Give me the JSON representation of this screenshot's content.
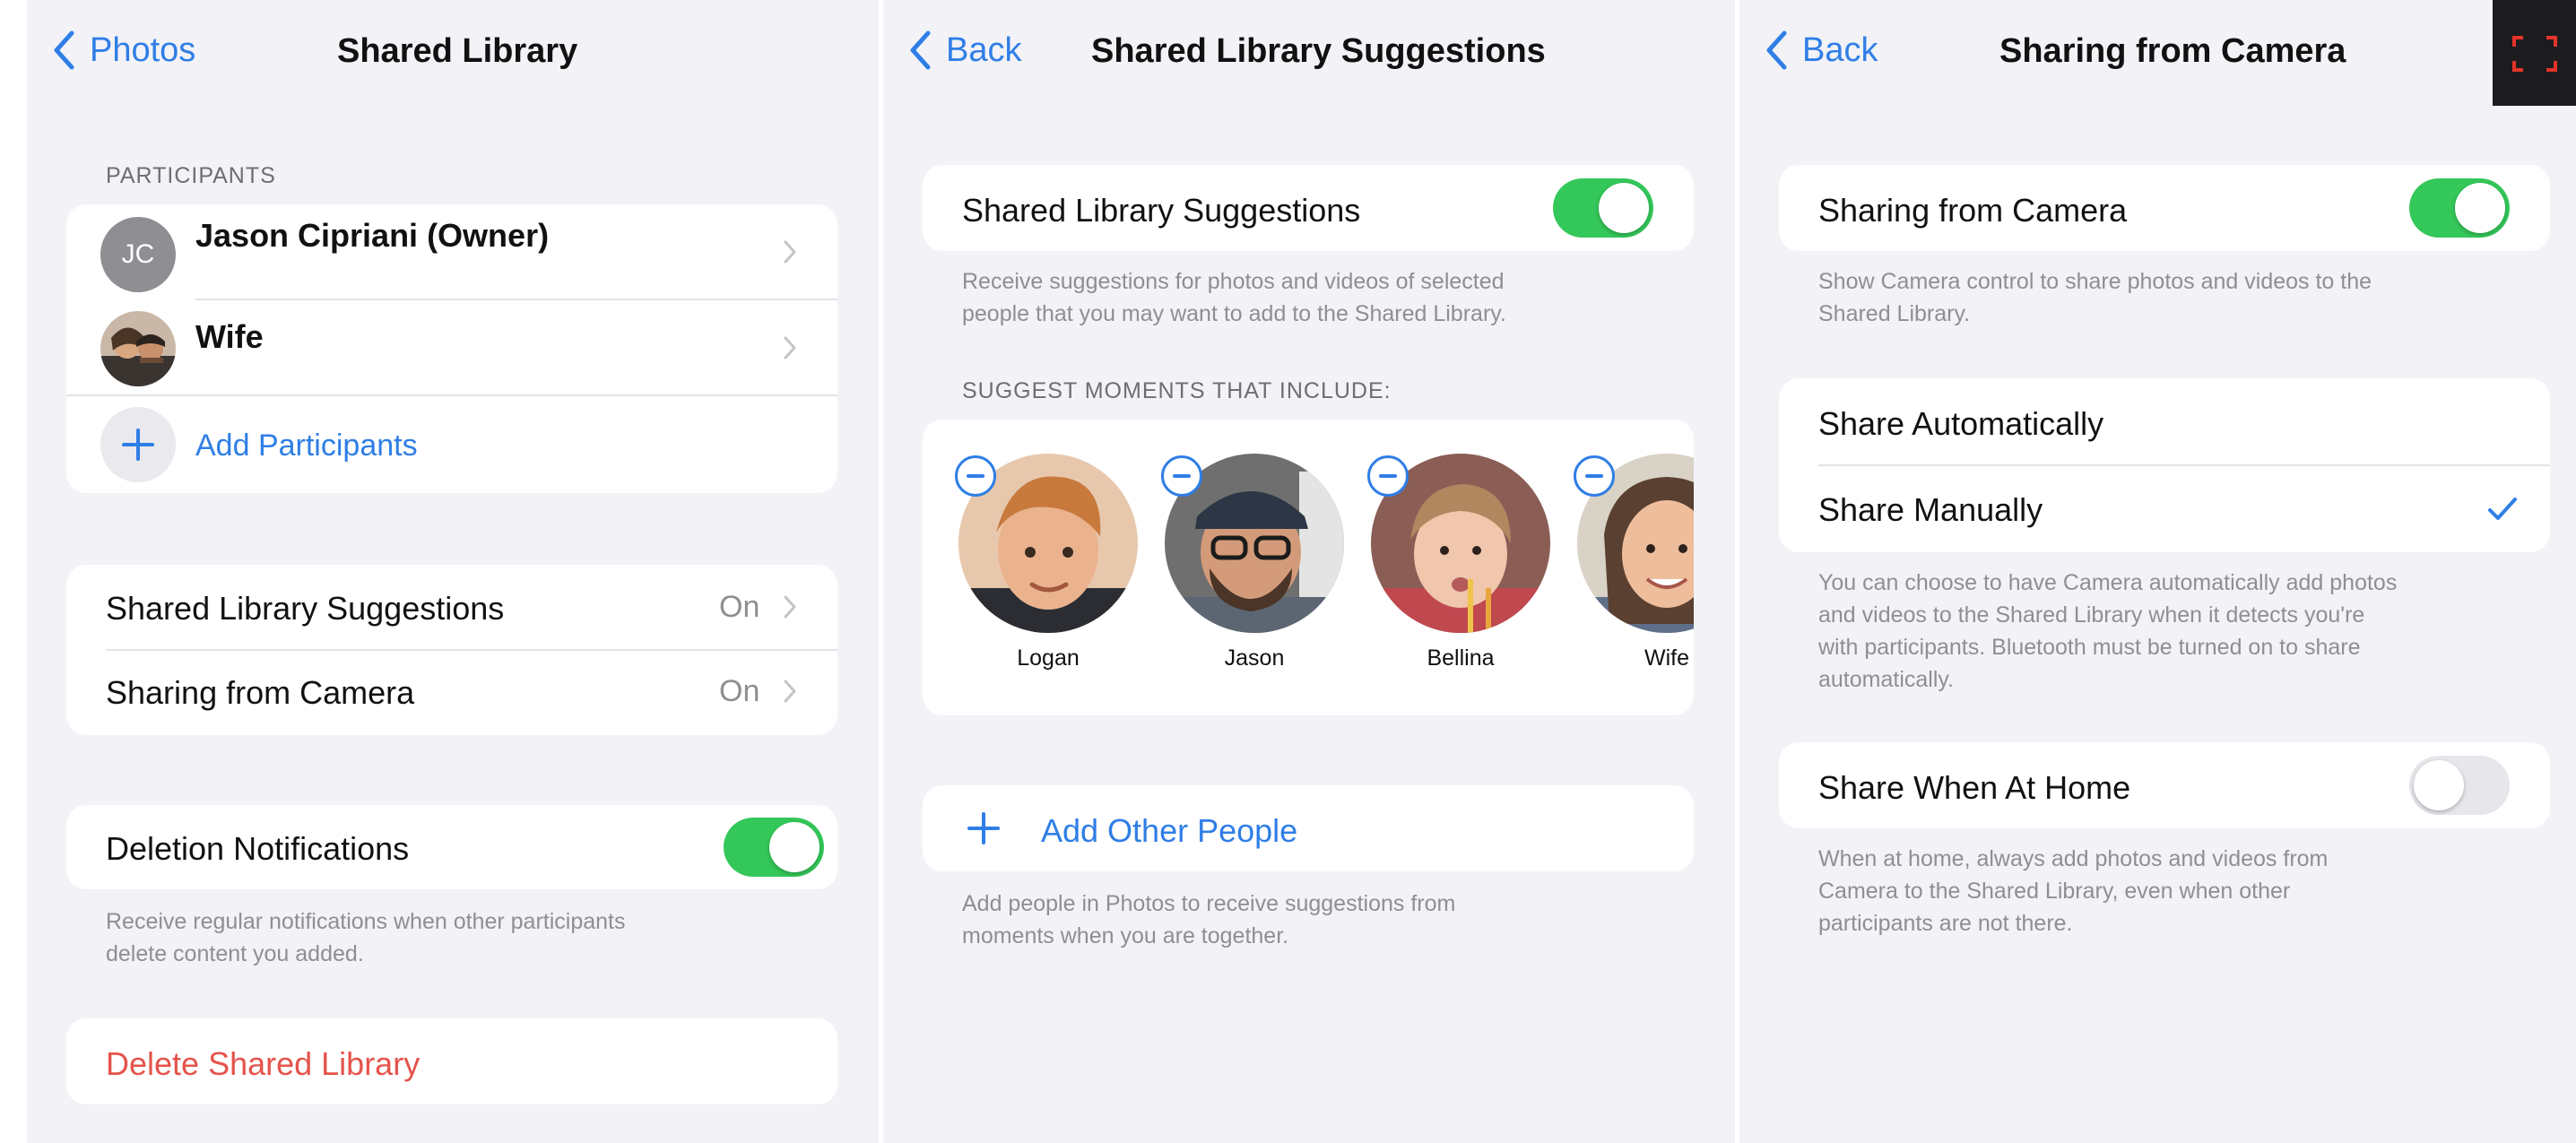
{
  "panel1": {
    "back_label": "Photos",
    "title": "Shared Library",
    "participants_header": "PARTICIPANTS",
    "participants": [
      {
        "initials": "JC",
        "name": "Jason Cipriani (Owner)"
      },
      {
        "initials": "",
        "name": "Wife"
      }
    ],
    "add_participants": "Add Participants",
    "settings": [
      {
        "label": "Shared Library Suggestions",
        "value": "On"
      },
      {
        "label": "Sharing from Camera",
        "value": "On"
      }
    ],
    "deletion_notifications": "Deletion Notifications",
    "deletion_notifications_state": "on",
    "deletion_footnote_1": "Receive regular notifications when other participants",
    "deletion_footnote_2": "delete content you added.",
    "delete_library": "Delete Shared Library"
  },
  "panel2": {
    "back_label": "Back",
    "title": "Shared Library Suggestions",
    "toggle_label": "Shared Library Suggestions",
    "toggle_state": "on",
    "footnote_1": "Receive suggestions for photos and videos of selected",
    "footnote_2": "people that you may want to add to the Shared Library.",
    "moments_header": "SUGGEST MOMENTS THAT INCLUDE:",
    "people": [
      {
        "name": "Logan"
      },
      {
        "name": "Jason"
      },
      {
        "name": "Bellina"
      },
      {
        "name": "Wife"
      }
    ],
    "add_other_people": "Add Other People",
    "add_footnote_1": "Add people in Photos to receive suggestions from",
    "add_footnote_2": "moments when you are together."
  },
  "panel3": {
    "back_label": "Back",
    "title": "Sharing from Camera",
    "toggle_label": "Sharing from Camera",
    "toggle_state": "on",
    "footnote_1": "Show Camera control to share photos and videos to the",
    "footnote_2": "Shared Library.",
    "share_automatically": "Share Automatically",
    "share_manually": "Share Manually",
    "selected_option": "Share Manually",
    "options_footnote_1": "You can choose to have Camera automatically add photos",
    "options_footnote_2": "and videos to the Shared Library when it detects you're",
    "options_footnote_3": "with participants. Bluetooth must be turned on to share",
    "options_footnote_4": "automatically.",
    "home_label": "Share When At Home",
    "home_state": "off",
    "home_footnote_1": "When at home, always add photos and videos from",
    "home_footnote_2": "Camera to the Shared Library, even when other",
    "home_footnote_3": "participants are not there."
  },
  "icons": {
    "back": "chevron-left-icon",
    "disclosure": "chevron-right-icon",
    "add": "plus-icon",
    "remove": "minus-circle-icon",
    "selected": "checkmark-icon",
    "expand": "expand-icon"
  },
  "colors": {
    "accent": "#2f7ee6",
    "toggle_on": "#34c759",
    "destructive": "#e5534b",
    "background": "#f2f2f7",
    "expand_marks": "#e5332a"
  }
}
